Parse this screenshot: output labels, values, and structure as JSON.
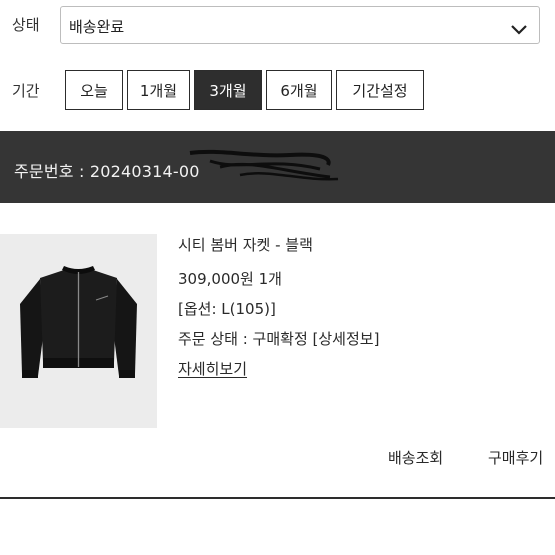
{
  "filter": {
    "status_label": "상태",
    "status_value": "배송완료",
    "period_label": "기간",
    "period_buttons": [
      "오늘",
      "1개월",
      "3개월",
      "6개월",
      "기간설정"
    ],
    "active_period": "3개월"
  },
  "order": {
    "number_text": "주문번호 : 20240314-00"
  },
  "product": {
    "name": "시티 봄버 자켓 - 블랙",
    "price_qty": "309,000원 1개",
    "option": "[옵션: L(105)]",
    "status_text": "주문 상태 : 구매확정 [상세정보]",
    "detail_link": "자세히보기"
  },
  "actions": {
    "track": "배송조회",
    "review": "구매후기"
  },
  "colors": {
    "header_bg": "#353535",
    "active_button_bg": "#2e2e2e",
    "thumbnail_bg": "#ececec"
  }
}
